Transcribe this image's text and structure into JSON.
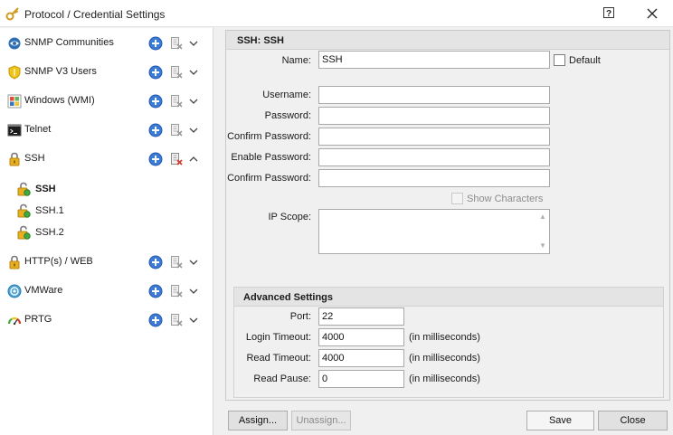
{
  "window": {
    "title": "Protocol / Credential Settings",
    "help_label": "?",
    "icons": {
      "app": "key-icon",
      "help": "help-icon",
      "close": "close-icon"
    }
  },
  "sidebar": {
    "categories": [
      {
        "label": "SNMP Communities",
        "icon": "snmp-community-icon",
        "expanded": false
      },
      {
        "label": "SNMP V3 Users",
        "icon": "shield-icon",
        "expanded": false
      },
      {
        "label": "Windows (WMI)",
        "icon": "windows-icon",
        "expanded": false
      },
      {
        "label": "Telnet",
        "icon": "terminal-icon",
        "expanded": false
      },
      {
        "label": "SSH",
        "icon": "lock-icon",
        "expanded": true,
        "children": [
          {
            "label": "SSH",
            "selected": true
          },
          {
            "label": "SSH.1",
            "selected": false
          },
          {
            "label": "SSH.2",
            "selected": false
          }
        ]
      },
      {
        "label": "HTTP(s) / WEB",
        "icon": "lock-icon",
        "expanded": false
      },
      {
        "label": "VMWare",
        "icon": "vmware-icon",
        "expanded": false
      },
      {
        "label": "PRTG",
        "icon": "gauge-icon",
        "expanded": false
      }
    ]
  },
  "form": {
    "header": "SSH: SSH",
    "name_label": "Name:",
    "name_value": "SSH",
    "default_label": "Default",
    "username_label": "Username:",
    "username_value": "",
    "password_label": "Password:",
    "password_value": "",
    "confirm_password_label": "Confirm Password:",
    "confirm_password_value": "",
    "enable_password_label": "Enable Password:",
    "enable_password_value": "",
    "confirm_enable_password_label": "Confirm Password:",
    "confirm_enable_password_value": "",
    "show_characters_label": "Show Characters",
    "ip_scope_label": "IP Scope:",
    "ip_scope_value": "",
    "advanced": {
      "header": "Advanced Settings",
      "port_label": "Port:",
      "port_value": "22",
      "login_timeout_label": "Login Timeout:",
      "login_timeout_value": "4000",
      "read_timeout_label": "Read Timeout:",
      "read_timeout_value": "4000",
      "read_pause_label": "Read Pause:",
      "read_pause_value": "0",
      "unit_label": "(in milliseconds)"
    }
  },
  "buttons": {
    "assign": "Assign...",
    "unassign": "Unassign...",
    "save": "Save",
    "close": "Close"
  },
  "colors": {
    "add_button": "#3b7ad9",
    "delete_button_active": "#d33b2c",
    "lock_gold": "#e8b020"
  }
}
